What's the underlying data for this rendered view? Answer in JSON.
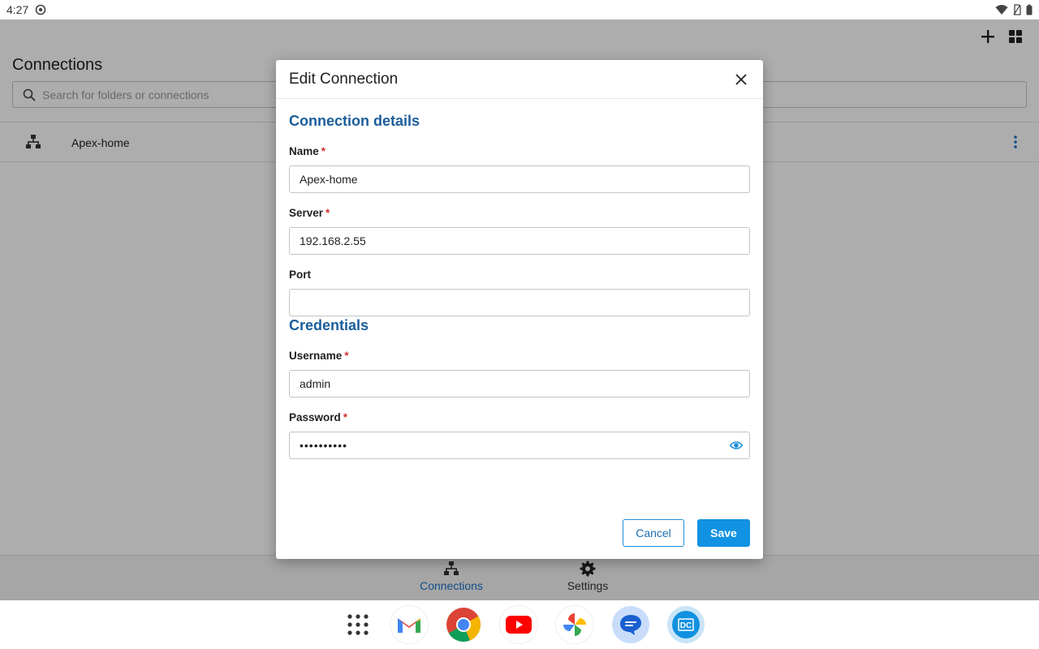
{
  "status_bar": {
    "time": "4:27"
  },
  "app": {
    "title": "Connections",
    "search_placeholder": "Search for folders or connections",
    "connection_row": {
      "label": "Apex-home"
    },
    "bottom_nav": [
      {
        "label": "Connections",
        "active": true
      },
      {
        "label": "Settings",
        "active": false
      }
    ]
  },
  "dialog": {
    "title": "Edit Connection",
    "section_connection": "Connection details",
    "name_label": "Name",
    "name_value": "Apex-home",
    "server_label": "Server",
    "server_value": "192.168.2.55",
    "port_label": "Port",
    "port_value": "",
    "section_credentials": "Credentials",
    "username_label": "Username",
    "username_value": "admin",
    "password_label": "Password",
    "password_value": "••••••••••",
    "required_marker": "*",
    "cancel_label": "Cancel",
    "save_label": "Save"
  },
  "colors": {
    "accent": "#1192e3",
    "section_title": "#1b5d9a",
    "required": "#d32f2f"
  },
  "dock": {
    "icons": [
      "app-drawer-icon",
      "gmail-icon",
      "chrome-icon",
      "youtube-icon",
      "photos-icon",
      "messages-icon",
      "dc-app-icon"
    ]
  }
}
